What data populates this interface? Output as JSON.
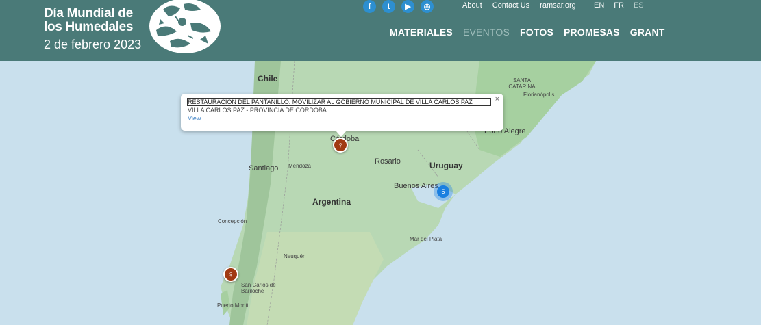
{
  "header": {
    "logo": {
      "line1": "Día Mundial de",
      "line2": "los Humedales",
      "date": "2 de febrero 2023"
    },
    "social": [
      {
        "name": "facebook-icon",
        "glyph": "f"
      },
      {
        "name": "twitter-icon",
        "glyph": "t"
      },
      {
        "name": "youtube-icon",
        "glyph": "▶"
      },
      {
        "name": "instagram-icon",
        "glyph": "◎"
      }
    ],
    "top_links": [
      "About",
      "Contact Us",
      "ramsar.org"
    ],
    "languages": [
      {
        "label": "EN",
        "active": false
      },
      {
        "label": "FR",
        "active": false
      },
      {
        "label": "ES",
        "active": true
      }
    ],
    "nav": [
      {
        "label": "MATERIALES",
        "active": false
      },
      {
        "label": "EVENTOS",
        "active": true
      },
      {
        "label": "FOTOS",
        "active": false
      },
      {
        "label": "PROMESAS",
        "active": false
      },
      {
        "label": "GRANT",
        "active": false
      }
    ],
    "bg_color": "#4a7a78"
  },
  "map": {
    "labels": {
      "chile": "Chile",
      "santa_catarina": "SANTA\nCATARINA",
      "florianopolis": "Florianópolis",
      "porto_alegre": "Porto Alegre",
      "cordoba": "Córdoba",
      "uruguay": "Uruguay",
      "rosario": "Rosario",
      "santiago": "Santiago",
      "mendoza": "Mendoza",
      "buenos_aires": "Buenos Aires",
      "argentina": "Argentina",
      "concepcion": "Concepción",
      "mar_del_plata": "Mar del Plata",
      "neuquen": "Neuquén",
      "bariloche": "San Carlos de\nBariloche",
      "puerto_montt": "Puerto Montt"
    },
    "cluster_count": "5",
    "popup": {
      "title": "RESTAURACION DEL PANTANILLO. MOVILIZAR AL GOBIERNO MUNICIPAL DE VILLA CARLOS PAZ",
      "subtitle": "VILLA CARLOS PAZ - PROVINCIA DE CORDOBA",
      "link": "View",
      "close": "×"
    }
  }
}
